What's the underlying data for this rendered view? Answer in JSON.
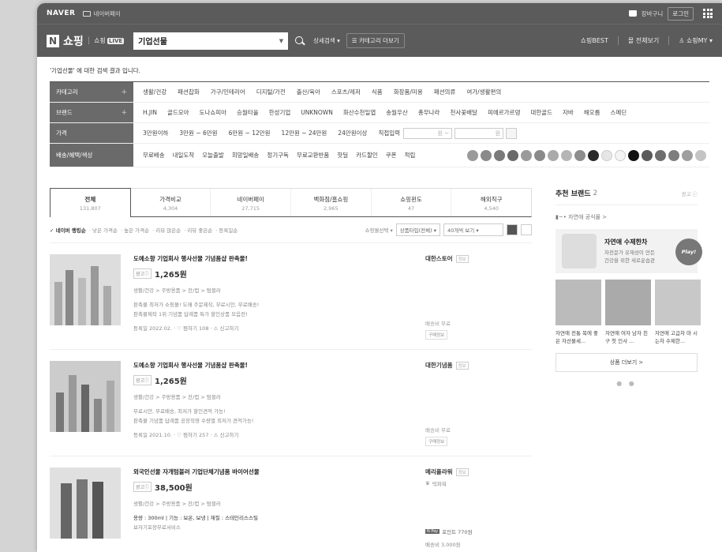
{
  "topbar": {
    "logo": "NAVER",
    "npay": "네이버페이",
    "cart": "장바구니",
    "login": "로그인"
  },
  "header": {
    "logo_n": "N",
    "logo_shop": "쇼핑",
    "logo_live": "쇼핑",
    "logo_live_badge": "LIVE",
    "search_value": "기업선물",
    "advanced": "상세검색 ▾",
    "category_more": "☰ 카테고리 더보기",
    "right_links": [
      "쇼핑BEST",
      "몰 전체보기",
      "♙ 쇼핑MY ▾"
    ]
  },
  "notice": "'기업선물' 에 대한 검색 결과 입니다.",
  "filters": {
    "category": {
      "label": "카테고리",
      "items": [
        "생활/건강",
        "패션잡화",
        "가구/인테리어",
        "디지털/가전",
        "출산/육아",
        "스포츠/레저",
        "식품",
        "화장품/미용",
        "패션의류",
        "여가/생활편의"
      ]
    },
    "brand": {
      "label": "브랜드",
      "items": [
        "H.JIN",
        "골드모아",
        "도나쇼피아",
        "승월타올",
        "한성기업",
        "UNKNOWN",
        "화산수천일엽",
        "송월우산",
        "총무나라",
        "천사꽃배달",
        "피에르가르뎅",
        "대한골드",
        "자바",
        "해오름",
        "스메딘"
      ]
    },
    "price": {
      "label": "가격",
      "items": [
        "3만원이하",
        "3만원 ~ 6만원",
        "6만원 ~ 12만원",
        "12만원 ~ 24만원",
        "24만원이상",
        "직접입력"
      ],
      "from_unit": "원 ~",
      "to_unit": "원"
    },
    "delivery": {
      "label": "배송/혜택/색상",
      "items": [
        "무료배송",
        "내일도착",
        "오늘출발",
        "희망일배송",
        "정기구독",
        "무료교환반품",
        "핫딜",
        "카드할인",
        "쿠폰",
        "적립"
      ],
      "colors": [
        "#9a9a9a",
        "#8a8a8a",
        "#7a7a7a",
        "#6a6a6a",
        "#9a9a9a",
        "#8a8a8a",
        "#aaaaaa",
        "#b5b5b5",
        "#8e8e8e",
        "#2a2a2a",
        "#e6e6e6",
        "#f4f4f4",
        "#111111",
        "#5a5a5a",
        "#6e6e6e",
        "#7e7e7e",
        "#9e9e9e",
        "#c4c4c4"
      ]
    }
  },
  "tabs": [
    {
      "label": "전체",
      "count": "131,807"
    },
    {
      "label": "가격비교",
      "count": "4,304"
    },
    {
      "label": "네이버페이",
      "count": "27,715"
    },
    {
      "label": "백화점/홈쇼핑",
      "count": "2,965"
    },
    {
      "label": "쇼핑윈도",
      "count": "47"
    },
    {
      "label": "해외직구",
      "count": "4,540"
    }
  ],
  "sort": {
    "active": "✓ 네이버 랭킹순",
    "others": [
      "· 낮은 가격순",
      "· 높은 가격순",
      "· 리뷰 많은순",
      "· 리뷰 좋은순",
      "· 등록일순"
    ],
    "mall_select": "쇼핑몰선택 ▾",
    "type_select": "상품타입(전체) ▾",
    "per_page": "40개씩 보기 ▾"
  },
  "products": [
    {
      "title": "도예소향 기업회사 행사선물 기념품샵 판촉물!",
      "ad": "광고ⓘ",
      "price": "1,265원",
      "category": "생활/건강 > 주방용품 > 잔/컵 > 텀블러",
      "desc1": "판촉물 최저가 쇼핑몰! 도매 주문제작, 무료시안, 무료배송!",
      "desc2": "판촉물제작 1위 기념품 답례품 특가 할인상품 모음전!",
      "meta": "등록일 2022.02. · ♡ 찜하기 108 · ⚠ 신고하기",
      "mall": "대한스토어",
      "mall_tag": "정보",
      "ship": "배송비 무료",
      "gbtn": "구매정보"
    },
    {
      "title": "도예소향 기업회사 행사선물 기념품샵 판촉물!",
      "ad": "광고ⓘ",
      "price": "1,265원",
      "category": "생활/건강 > 주방용품 > 잔/컵 > 텀블러",
      "desc1": "무료시안, 무료배송, 최저가 할인견적 가능!",
      "desc2": "판촉물 기념품 답례품 공장직영 수량별 최저가 견적가능!",
      "meta": "등록일 2021.10. · ♡ 찜하기 257 · ⚠ 신고하기",
      "mall": "대한기념품",
      "mall_tag": "정보",
      "ship": "배송비 무료",
      "gbtn": "구매정보"
    },
    {
      "title": "외국인선물 자개텀블러 기업단체기념품 바이어선물",
      "ad": "광고ⓘ",
      "price": "38,500원",
      "category": "생활/건강 > 주방용품 > 잔/컵 > 텀블러",
      "desc1": "용량 : 300ml  |  기능 : 보온, 보냉  |  재질 : 스테인리스스틸",
      "desc2": "보자기포장무료서비스",
      "mall": "메리플라워",
      "mall_tag": "정보",
      "mall_sub": "빅파워",
      "pay_badge": "N Pay",
      "pay": "포인트 770원",
      "ship": "배송비 3,000원"
    }
  ],
  "right": {
    "title": "추천 브랜드",
    "count": "2",
    "ad": "광고 ⓘ",
    "link": "자연애 공식몰 >",
    "link_brand": "▮~•",
    "card_title": "자연애 수제한차",
    "card_sub1": "차전문가 유재성이 만든",
    "card_sub2": "건강을 위한 새로운습관",
    "play": "Play!",
    "thumbs": [
      "자연애 전통 목에 좋은 자선물세...",
      "자연애 여자 남자 친구 첫 인사 ...",
      "자연애 고급차 마 시는차 수제한..."
    ],
    "more": "상품 더보기 >",
    "dots": "● ●"
  }
}
